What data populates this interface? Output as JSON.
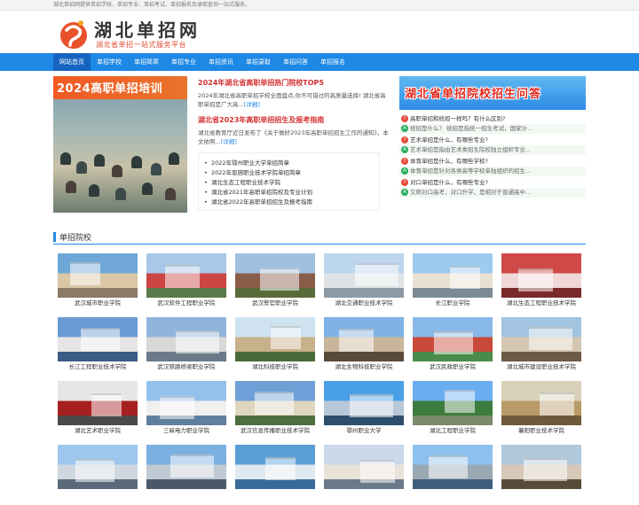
{
  "topbar": {
    "text": "湖北单招网提供单招学校、单招专业、单招考试、单招报名及录取查询一站式服务。"
  },
  "logo": {
    "title": "湖北单招网",
    "subtitle": "湖北省单招一站式服务平台"
  },
  "nav": {
    "items": [
      "网站首页",
      "单招学校",
      "单招简章",
      "单招专业",
      "单招资讯",
      "单招录取",
      "单招问答",
      "单招报名"
    ]
  },
  "hero": {
    "banner": "2024高职单招培训"
  },
  "news": [
    {
      "title": "2024年湖北省高职单招热门院校TOP5",
      "body": "2024年湖北省高职单招学校全面盘点,你不可错过的高质量选择! 湖北省高职单招是广大高...",
      "more": "[详细]"
    },
    {
      "title": "湖北省2023年高职单招招生及报考指南",
      "body": "湖北省教育厅近日发布了《关于做好2023年高职单招招生工作的通知》，本文依照...",
      "more": "[详细]"
    }
  ],
  "bullets": [
    "2022年鄂州职业大学单招简章",
    "2022年恩施职业技术学院单招简章",
    "湖北生态工程职业技术学院",
    "湖北省2021年高职单招院校及专业计划",
    "湖北省2022年高职单招招生及报考指南"
  ],
  "qa": {
    "banner": "湖北省单招院校招生问答",
    "items": [
      {
        "q": "高职单招和统招一样吗？有什么区别?",
        "a": "统招是什么？ 统招是指统一招生考试，国家计..."
      },
      {
        "q": "艺术单招是什么，有哪些专业?",
        "a": "艺术单招是指由艺术类招生院校独立组织专业..."
      },
      {
        "q": "体育单招是什么，有哪些学校?",
        "a": "体育单招是针对各类高等学校单独组织的招生..."
      },
      {
        "q": "对口单招是什么，有哪些专业?",
        "a": "又称对口高考，对口升学，是相对于普通高中..."
      }
    ]
  },
  "section": {
    "title": "单招院校"
  },
  "schools": [
    "武汉城市职业学院",
    "武汉软件工程职业学院",
    "武汉警官职业学院",
    "湖北交通职业技术学院",
    "长江职业学院",
    "湖北生态工程职业技术学院",
    "长江工程职业技术学院",
    "武汉铁路桥梁职业学院",
    "湖北科技职业学院",
    "湖北生物科技职业学院",
    "武汉民政职业学院",
    "湖北城市建设职业技术学院",
    "湖北艺术职业学院",
    "三峡电力职业学院",
    "武汉信息传播职业技术学院",
    "鄂州职业大学",
    "湖北工程职业学院",
    "襄阳职业技术学院",
    "",
    "",
    "",
    "",
    "",
    ""
  ],
  "colors": {
    "nav": "#1e88e5",
    "accent": "#d32f2f"
  }
}
